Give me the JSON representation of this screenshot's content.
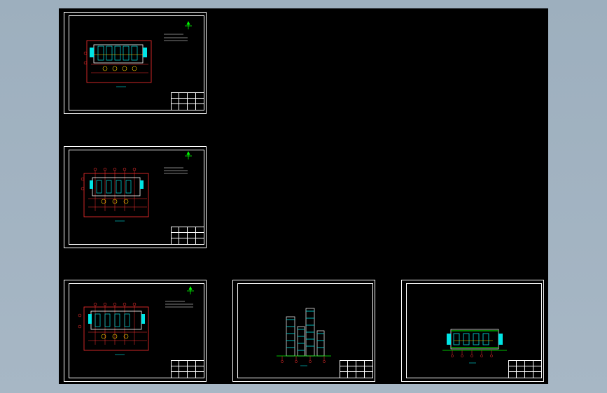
{
  "viewport": {
    "background": "#a3b4c2",
    "canvas_background": "#000000"
  },
  "sheets": [
    {
      "id": "sheet-1",
      "kind": "plan"
    },
    {
      "id": "sheet-2",
      "kind": "plan"
    },
    {
      "id": "sheet-3",
      "kind": "plan"
    },
    {
      "id": "sheet-4",
      "kind": "elevation"
    },
    {
      "id": "sheet-5",
      "kind": "elevation"
    }
  ],
  "colors": {
    "frame": "#ffffff",
    "axis": "#ff3030",
    "wall": "#ffffff",
    "cyan": "#00e5e5",
    "green": "#00ff00",
    "yellow": "#ffd000"
  }
}
